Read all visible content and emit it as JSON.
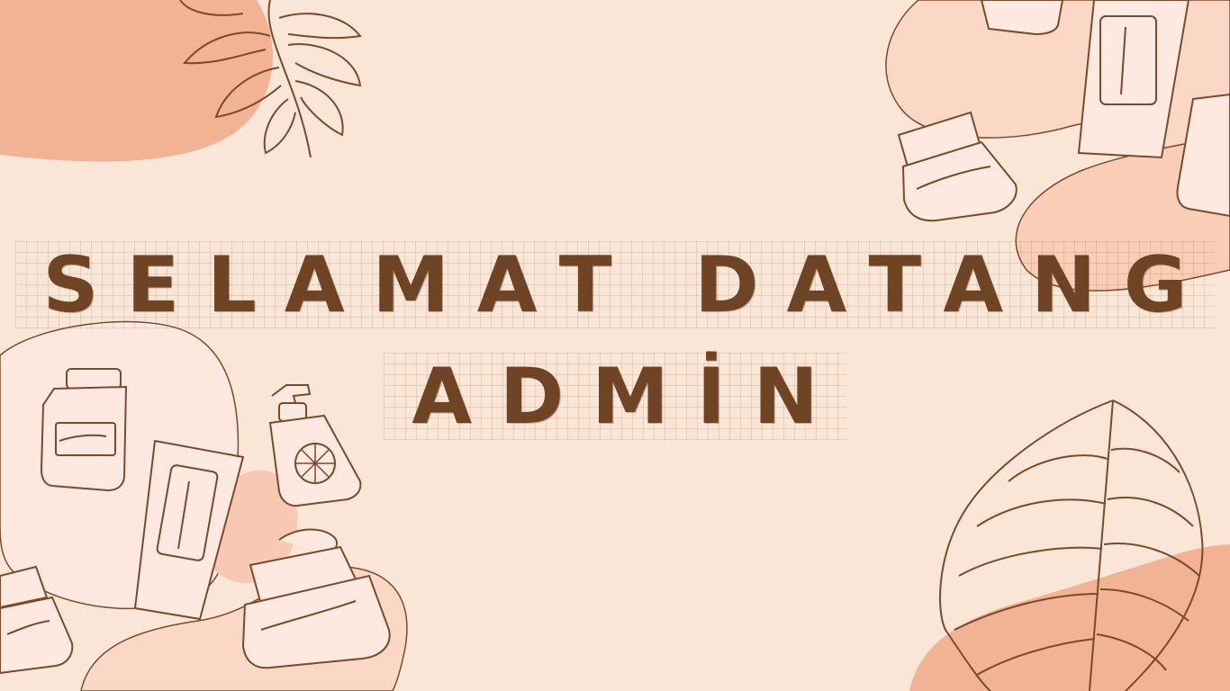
{
  "heading": {
    "line1": "SELAMAT DATANG",
    "line2": "ADMİN"
  },
  "colors": {
    "background": "#fae6d6",
    "text": "#6e4424",
    "blob_dark": "#f1b394",
    "blob_light": "#fbd8c6",
    "stroke": "#7a4a2a"
  },
  "decorations": [
    "leaf-icon",
    "monstera-leaf-icon",
    "skincare-bottle-icon",
    "cream-jar-icon",
    "lotion-tube-icon",
    "pump-bottle-icon"
  ]
}
